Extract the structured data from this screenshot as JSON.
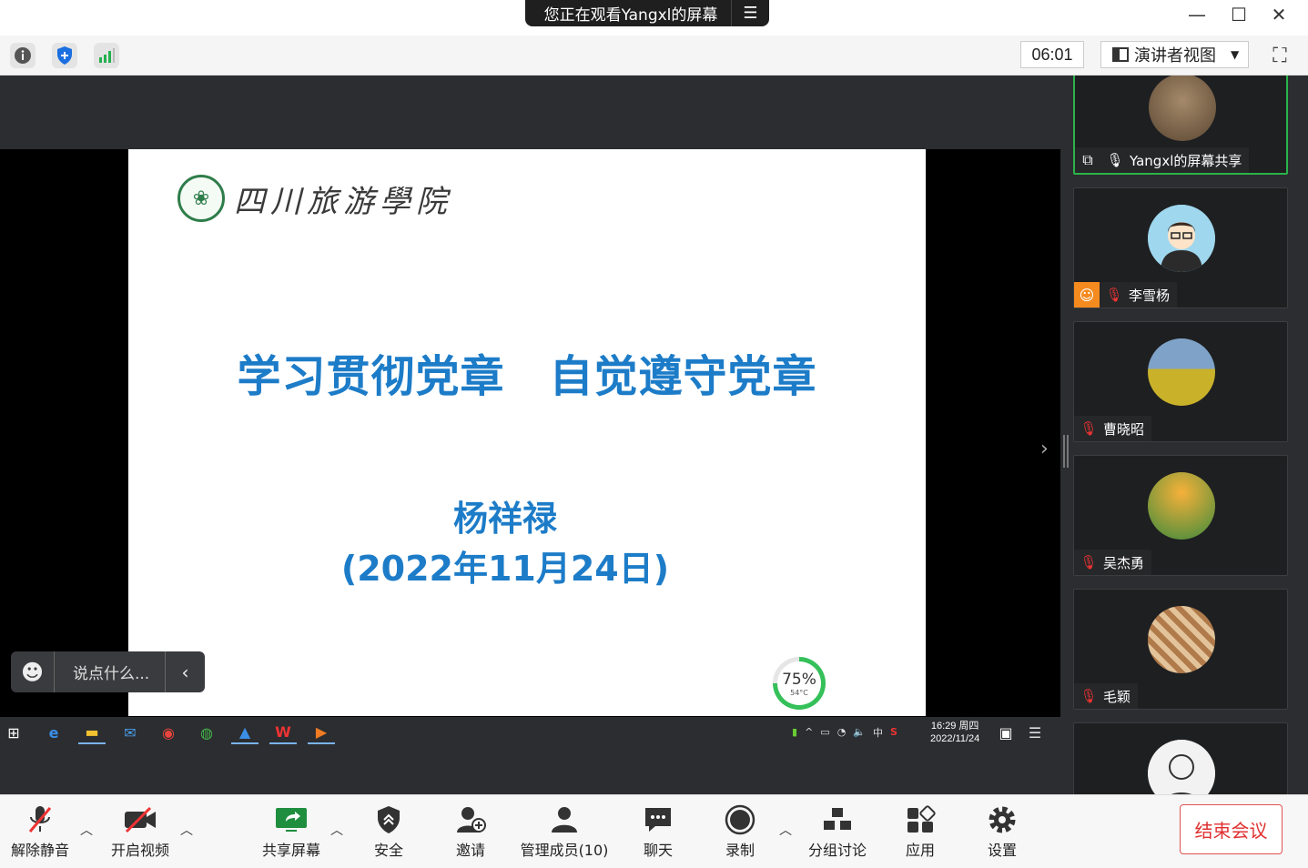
{
  "window": {
    "share_banner": "您正在观看Yangxl的屏幕",
    "banner_menu_icon": "menu-icon",
    "controls": [
      "minimize-icon",
      "maximize-icon",
      "close-icon"
    ]
  },
  "toolbar": {
    "timer": "06:01",
    "view_mode": "演讲者视图",
    "icons": [
      "info-icon",
      "shield-icon",
      "signal-icon",
      "fullscreen-icon"
    ]
  },
  "slide": {
    "logo_text": "四川旅游學院",
    "title": "学习贯彻党章　自觉遵守党章",
    "author": "杨祥禄",
    "date": "(2022年11月24日)",
    "gauge_percent": "75%",
    "gauge_temp": "54°C",
    "gauge_value": 0.75
  },
  "taskbar": {
    "clock_time": "16:29 周四",
    "clock_date": "2022/11/24",
    "ime": "中"
  },
  "chat": {
    "placeholder": "说点什么..."
  },
  "participants": [
    {
      "name": "Yangxl的屏幕共享",
      "status": "sharing"
    },
    {
      "name": "李雪杨",
      "status": "muted"
    },
    {
      "name": "曹晓昭",
      "status": "muted"
    },
    {
      "name": "吴杰勇",
      "status": "muted"
    },
    {
      "name": "毛颖",
      "status": "muted"
    }
  ],
  "bottombar": {
    "unmute": "解除静音",
    "start_video": "开启视频",
    "share_screen": "共享屏幕",
    "security": "安全",
    "invite": "邀请",
    "participants": "管理成员(10)",
    "chat": "聊天",
    "record": "录制",
    "breakout": "分组讨论",
    "apps": "应用",
    "settings": "设置",
    "end_meeting": "结束会议"
  },
  "colors": {
    "slide_title": "#1d7cc8",
    "end_button": "#e03030",
    "active_tile": "#2bb34a"
  }
}
